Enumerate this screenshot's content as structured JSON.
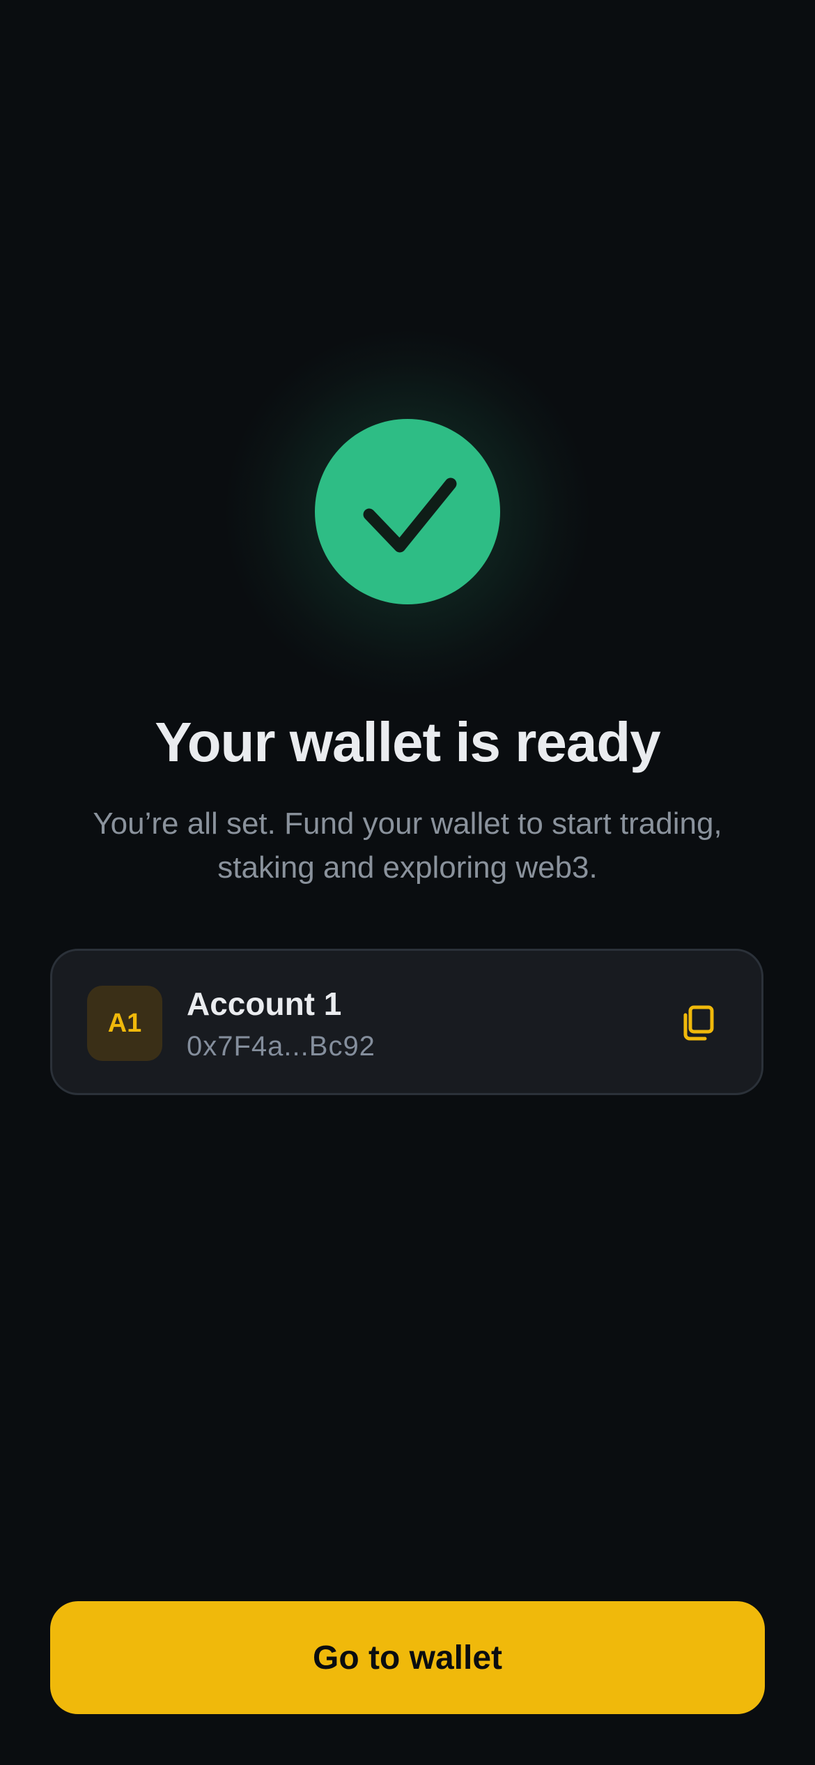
{
  "success": {
    "icon": "checkmark-icon",
    "title": "Your wallet is ready",
    "subtitle": "You’re all set. Fund your wallet to start trading, staking and exploring web3."
  },
  "account": {
    "avatar_label": "A1",
    "name": "Account 1",
    "address": "0x7F4a...Bc92",
    "copy_icon": "copy-icon"
  },
  "actions": {
    "primary_label": "Go to wallet"
  },
  "colors": {
    "background": "#0a0d10",
    "success_green": "#2ebd85",
    "accent_yellow": "#f0b90b",
    "card_background": "#181b20",
    "card_border": "#2b3139",
    "title_text": "#eaecef",
    "muted_text": "#848e9c"
  }
}
